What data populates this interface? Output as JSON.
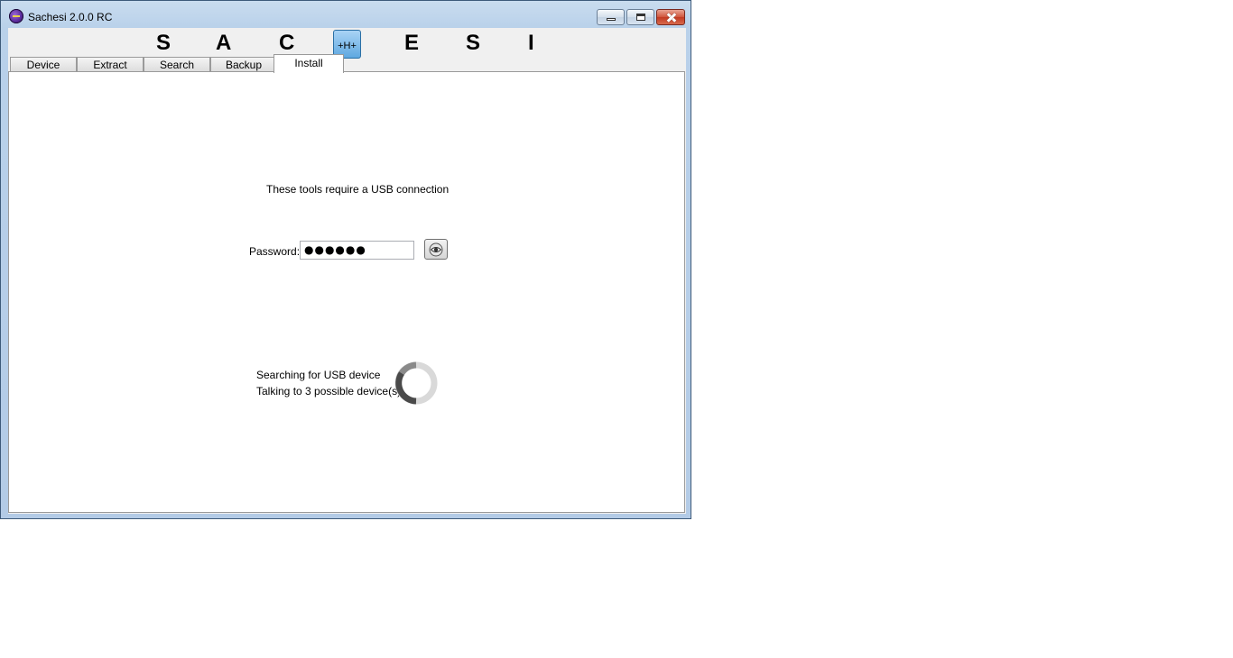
{
  "window": {
    "title": "Sachesi 2.0.0 RC"
  },
  "brand": {
    "letters": [
      "S",
      "A",
      "C",
      "E",
      "S",
      "I"
    ],
    "badge": "+H+"
  },
  "tabs": [
    {
      "label": "Device",
      "active": false
    },
    {
      "label": "Extract",
      "active": false
    },
    {
      "label": "Search",
      "active": false
    },
    {
      "label": "Backup",
      "active": false
    },
    {
      "label": "Install",
      "active": true
    }
  ],
  "install": {
    "usb_message": "These tools require a USB connection",
    "password_label": "Password:",
    "password_value": "●●●●●●",
    "show_password_icon": "eye-icon",
    "status_line1": "Searching for USB device",
    "status_line2": "Talking to 3 possible device(s)."
  }
}
